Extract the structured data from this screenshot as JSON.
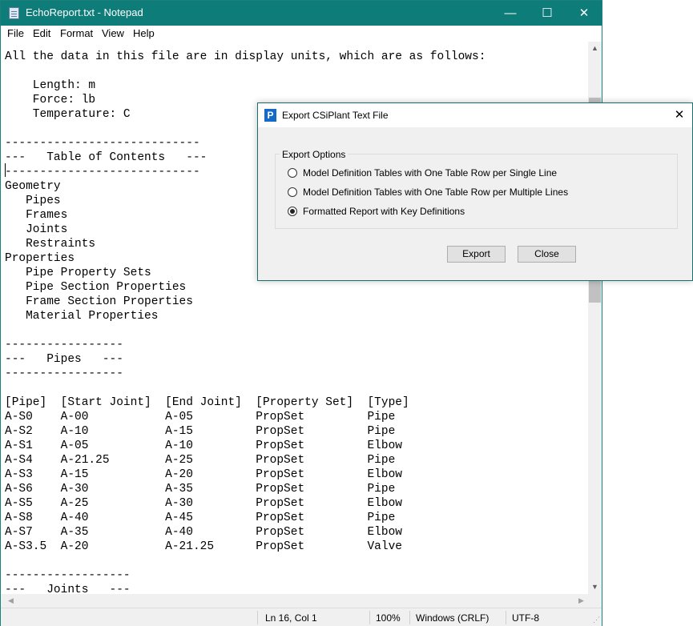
{
  "notepad": {
    "title": "EchoReport.txt - Notepad",
    "controls": {
      "minimize": "—",
      "maximize": "☐",
      "close": "✕"
    },
    "menu": [
      "File",
      "Edit",
      "Format",
      "View",
      "Help"
    ],
    "content": "All the data in this file are in display units, which are as follows:\n\n    Length: m\n    Force: lb\n    Temperature: C\n\n----------------------------\n---   Table of Contents   ---\n----------------------------\nGeometry\n   Pipes\n   Frames\n   Joints\n   Restraints\nProperties\n   Pipe Property Sets\n   Pipe Section Properties\n   Frame Section Properties\n   Material Properties\n\n-----------------\n---   Pipes   ---\n-----------------\n\n[Pipe]  [Start Joint]  [End Joint]  [Property Set]  [Type]\nA-S0    A-00           A-05         PropSet         Pipe\nA-S2    A-10           A-15         PropSet         Pipe\nA-S1    A-05           A-10         PropSet         Elbow\nA-S4    A-21.25        A-25         PropSet         Pipe\nA-S3    A-15           A-20         PropSet         Elbow\nA-S6    A-30           A-35         PropSet         Pipe\nA-S5    A-25           A-30         PropSet         Elbow\nA-S8    A-40           A-45         PropSet         Pipe\nA-S7    A-35           A-40         PropSet         Elbow\nA-S3.5  A-20           A-21.25      PropSet         Valve\n\n------------------\n---   Joints   ---\n------------------\n\n[Joint]   [X Coord (m)]  [Y Coord (m)]  [Z Coord (m)]",
    "status": {
      "position": "Ln 16, Col 1",
      "zoom": "100%",
      "line_ending": "Windows (CRLF)",
      "encoding": "UTF-8"
    }
  },
  "dialog": {
    "title": "Export CSiPlant Text File",
    "icon_letter": "P",
    "close": "✕",
    "group_label": "Export Options",
    "options": [
      {
        "label": "Model Definition Tables with One Table Row per Single Line",
        "selected": false
      },
      {
        "label": "Model Definition Tables with One Table Row per Multiple Lines",
        "selected": false
      },
      {
        "label": "Formatted Report with Key Definitions",
        "selected": true
      }
    ],
    "export_button": "Export",
    "close_button": "Close"
  },
  "colors": {
    "titlebar": "#0e7d7a",
    "dialog_icon": "#1569c7"
  }
}
